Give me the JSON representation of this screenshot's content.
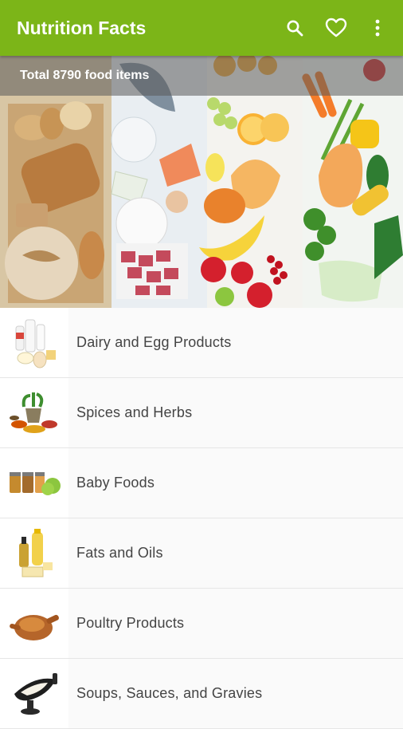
{
  "app_bar": {
    "title": "Nutrition Facts",
    "icons": [
      "search-icon",
      "heart-icon",
      "more-vert-icon"
    ]
  },
  "hero": {
    "summary": "Total 8790 food items"
  },
  "categories": [
    {
      "label": "Dairy and Egg Products",
      "icon": "dairy-icon"
    },
    {
      "label": "Spices and Herbs",
      "icon": "spices-icon"
    },
    {
      "label": "Baby Foods",
      "icon": "baby-foods-icon"
    },
    {
      "label": "Fats and Oils",
      "icon": "oils-icon"
    },
    {
      "label": "Poultry Products",
      "icon": "poultry-icon"
    },
    {
      "label": "Soups, Sauces, and Gravies",
      "icon": "gravy-icon"
    }
  ],
  "colors": {
    "app_bar": "#7cb518",
    "row_background": "#fafafa",
    "label_text": "#444444"
  }
}
